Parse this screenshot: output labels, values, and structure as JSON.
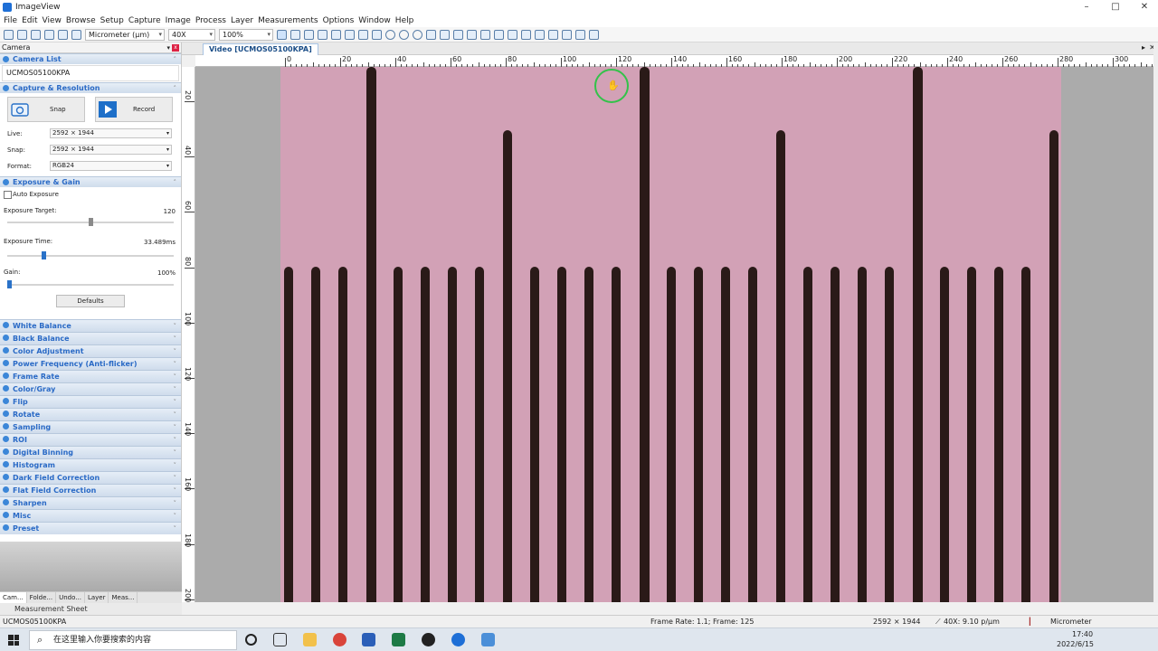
{
  "app": {
    "title": "ImageView",
    "window_controls": [
      "–",
      "□",
      "✕"
    ]
  },
  "menu": [
    "File",
    "Edit",
    "View",
    "Browse",
    "Setup",
    "Capture",
    "Image",
    "Process",
    "Layer",
    "Measurements",
    "Options",
    "Window",
    "Help"
  ],
  "toolbar": {
    "unit": "Micrometer (µm)",
    "objective": "40X",
    "zoom": "100%"
  },
  "left_panel": {
    "header": "Camera",
    "camera_list": {
      "title": "Camera List",
      "camera": "UCMOS05100KPA"
    },
    "capture": {
      "title": "Capture & Resolution",
      "snap_label": "Snap",
      "record_label": "Record",
      "live_label": "Live:",
      "live_value": "2592 × 1944",
      "snap_res_label": "Snap:",
      "snap_value": "2592 × 1944",
      "format_label": "Format:",
      "format_value": "RGB24"
    },
    "exposure": {
      "title": "Exposure & Gain",
      "auto_exposure": "Auto Exposure",
      "auto_exposure_checked": false,
      "target_label": "Exposure Target:",
      "target_value": "120",
      "time_label": "Exposure Time:",
      "time_value": "33.489ms",
      "gain_label": "Gain:",
      "gain_value": "100%",
      "defaults_label": "Defaults"
    },
    "sections": [
      "White Balance",
      "Black Balance",
      "Color Adjustment",
      "Power Frequency (Anti-flicker)",
      "Frame Rate",
      "Color/Gray",
      "Flip",
      "Rotate",
      "Sampling",
      "ROI",
      "Digital Binning",
      "Histogram",
      "Dark Field Correction",
      "Flat Field Correction",
      "Sharpen",
      "Misc",
      "Preset"
    ],
    "bottom_tabs": [
      "Cam...",
      "Folde...",
      "Undo...",
      "Layer",
      "Meas..."
    ]
  },
  "document_tab": "Video [UCMOS05100KPA]",
  "ruler": {
    "h_labels": [
      "0",
      "20",
      "40",
      "60",
      "80",
      "100",
      "120",
      "140",
      "160",
      "180",
      "200",
      "220",
      "240",
      "260",
      "280",
      "300"
    ],
    "v_labels": [
      "20",
      "40",
      "60",
      "80",
      "100",
      "120",
      "140",
      "160",
      "180",
      "200"
    ]
  },
  "measurement_sheet": "Measurement Sheet",
  "status": {
    "camera": "UCMOS05100KPA",
    "frame": "Frame Rate: 1.1; Frame: 125",
    "resolution": "2592 × 1944",
    "magnification": "40X: 9.10 p/µm",
    "unit": "Micrometer"
  },
  "taskbar": {
    "search_placeholder": "在这里输入你要搜索的内容",
    "time": "17:40",
    "date": "2022/6/15"
  },
  "colors": {
    "accent": "#2a6ac6",
    "specimen": "#d2a1b6",
    "scale_line": "#2a1a18"
  }
}
